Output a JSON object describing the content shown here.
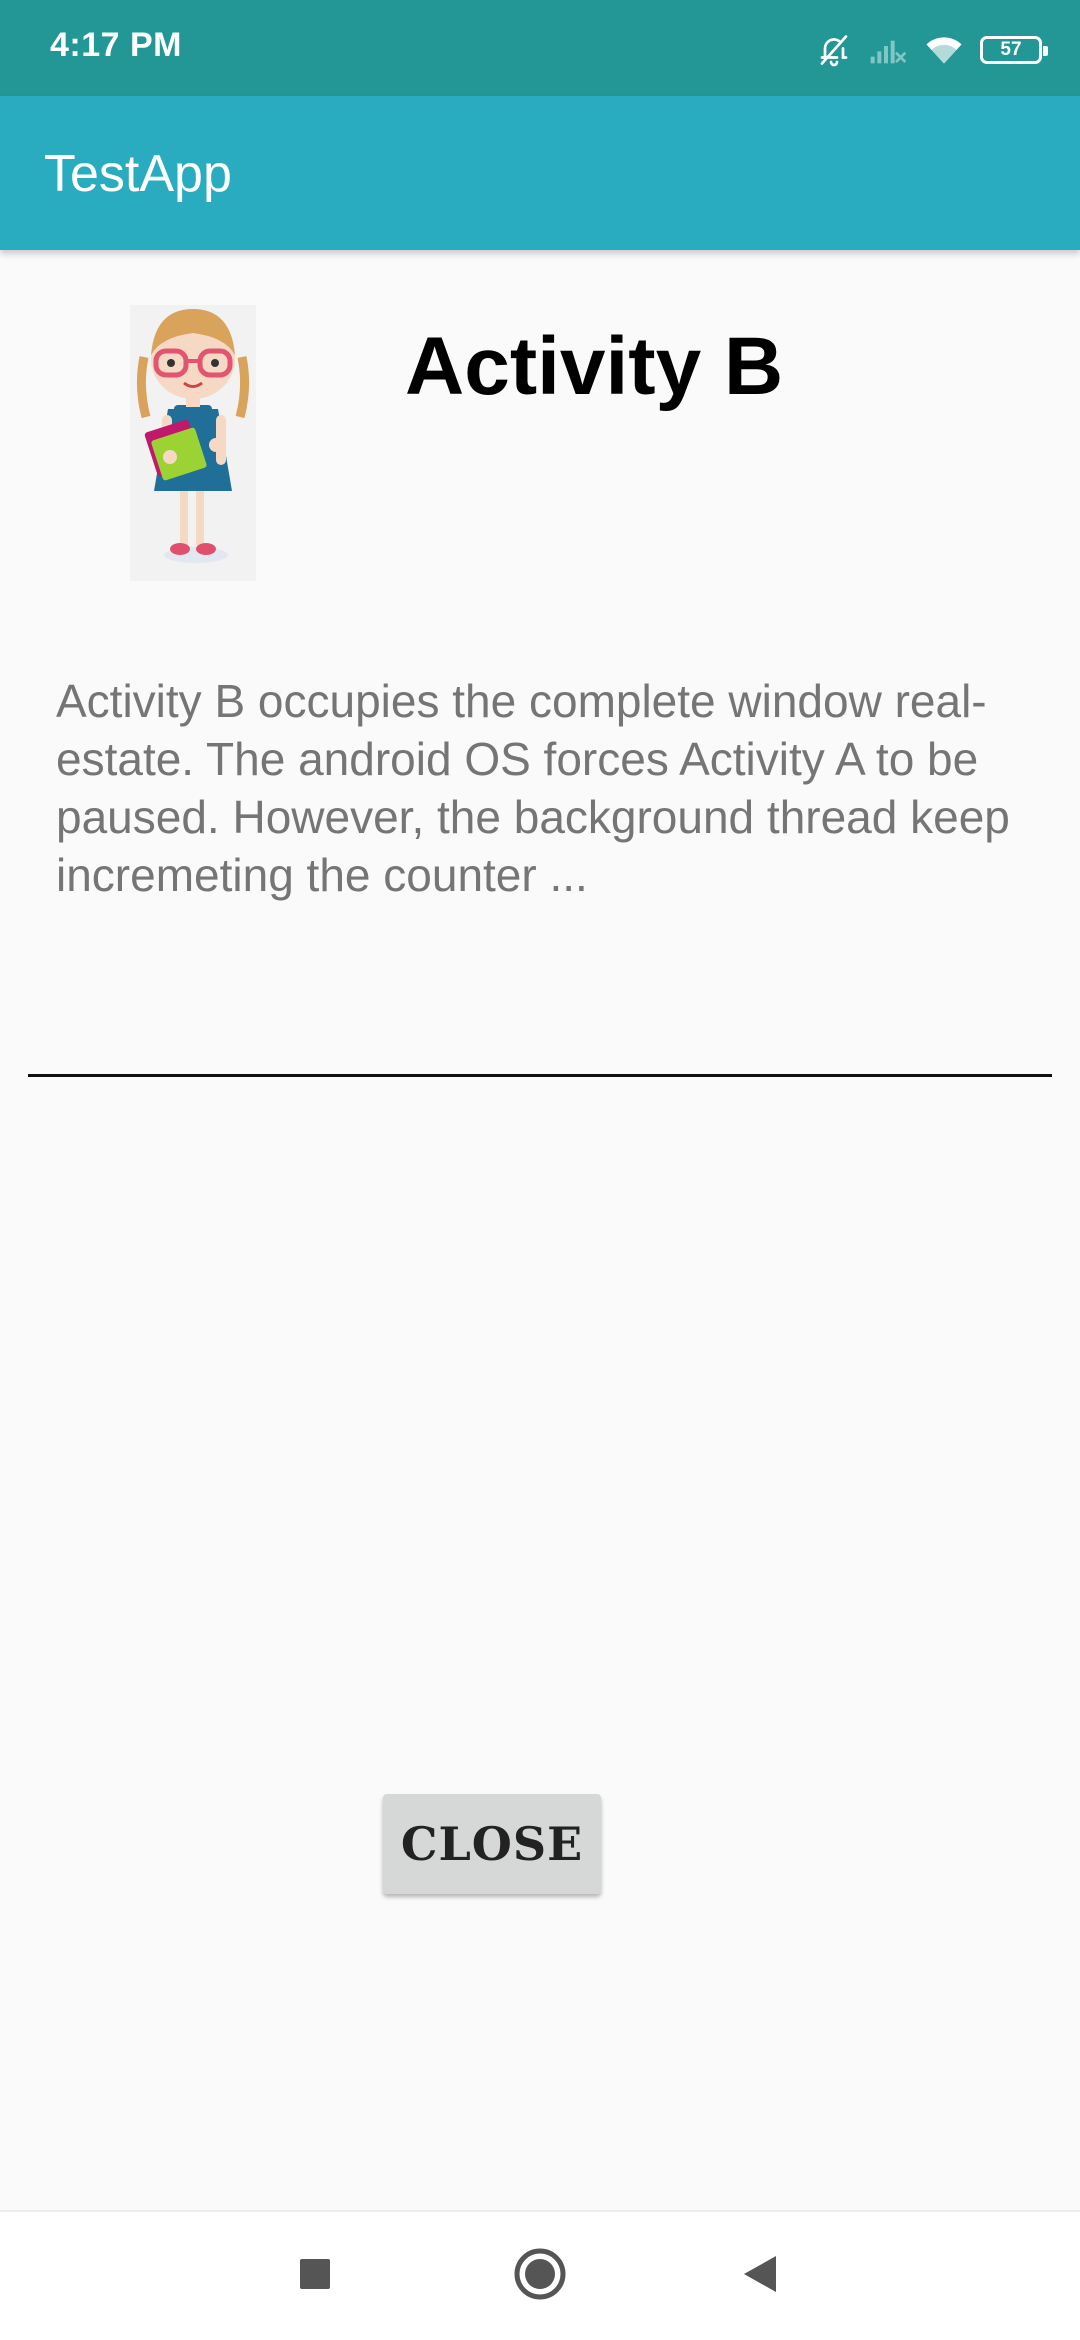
{
  "status_bar": {
    "time": "4:17 PM",
    "battery_level": "57",
    "icons": [
      "bell-off-icon",
      "signal-off-icon",
      "wifi-icon",
      "battery-icon"
    ]
  },
  "app_bar": {
    "title": "TestApp"
  },
  "content": {
    "heading": "Activity B",
    "description": "Activity B occupies the complete window real-estate. The android OS forces Activity A to be paused. However, the background thread keep incremeting the counter ...",
    "close_label": "CLOSE"
  },
  "nav_bar": {
    "buttons": [
      "recents-icon",
      "home-icon",
      "back-icon"
    ]
  },
  "colors": {
    "status_bar": "#229796",
    "app_bar": "#29acc0",
    "background": "#fafafa",
    "description_text": "#757575",
    "button": "#d6d7d7"
  }
}
